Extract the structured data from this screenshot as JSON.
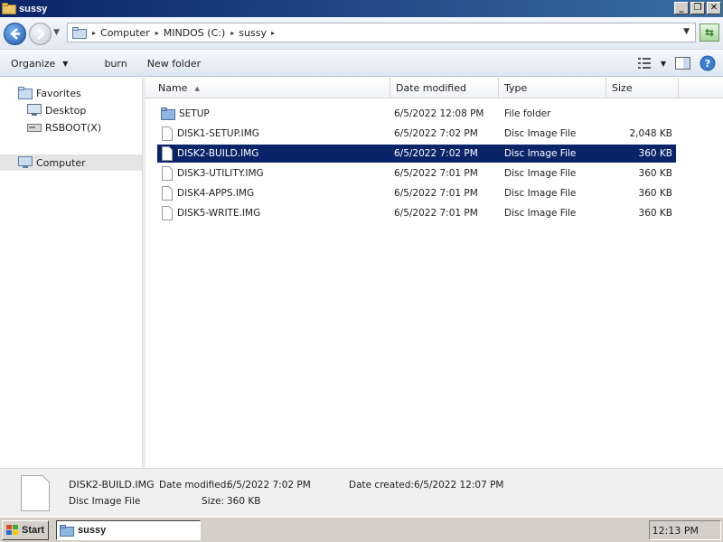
{
  "window": {
    "title": "sussy"
  },
  "address": {
    "crumbs": [
      "Computer",
      "MINDOS (C:)",
      "sussy"
    ]
  },
  "commandbar": {
    "organize": "Organize",
    "burn": "burn",
    "new_folder": "New folder"
  },
  "navpane": {
    "favorites": "Favorites",
    "desktop": "Desktop",
    "rsboot": "RSBOOT(X)",
    "computer": "Computer"
  },
  "columns": {
    "name": "Name",
    "date": "Date modified",
    "type": "Type",
    "size": "Size"
  },
  "files": [
    {
      "name": "SETUP",
      "date": "6/5/2022 12:08 PM",
      "type": "File folder",
      "size": "",
      "icon": "folder-icon"
    },
    {
      "name": "DISK1-SETUP.IMG",
      "date": "6/5/2022 7:02 PM",
      "type": "Disc Image File",
      "size": "2,048 KB",
      "icon": "file-icon"
    },
    {
      "name": "DISK2-BUILD.IMG",
      "date": "6/5/2022 7:02 PM",
      "type": "Disc Image File",
      "size": "360 KB",
      "icon": "file-icon",
      "selected": true
    },
    {
      "name": "DISK3-UTILITY.IMG",
      "date": "6/5/2022 7:01 PM",
      "type": "Disc Image File",
      "size": "360 KB",
      "icon": "file-icon"
    },
    {
      "name": "DISK4-APPS.IMG",
      "date": "6/5/2022 7:01 PM",
      "type": "Disc Image File",
      "size": "360 KB",
      "icon": "file-icon"
    },
    {
      "name": "DISK5-WRITE.IMG",
      "date": "6/5/2022 7:01 PM",
      "type": "Disc Image File",
      "size": "360 KB",
      "icon": "file-icon"
    }
  ],
  "details": {
    "name": "DISK2-BUILD.IMG",
    "kind": "Disc Image File",
    "modified_label": "Date modified:",
    "modified_value": "6/5/2022 7:02 PM",
    "size_label": "Size:",
    "size_value": "360 KB",
    "created_label": "Date created:",
    "created_value": "6/5/2022 12:07 PM"
  },
  "taskbar": {
    "start": "Start",
    "item": "sussy",
    "clock": "12:13 PM"
  },
  "colors": {
    "selection": "#0a246a",
    "titlebar": "#0a246a"
  }
}
